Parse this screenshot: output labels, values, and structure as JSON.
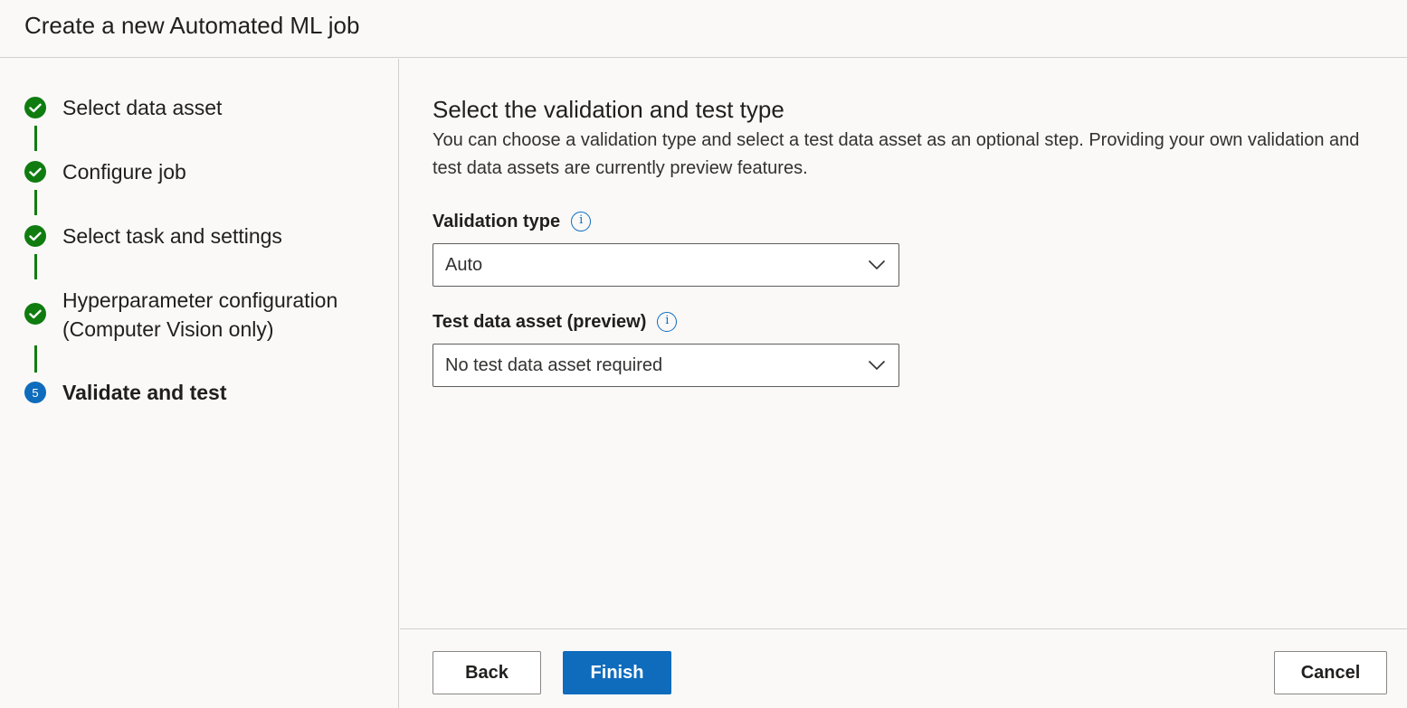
{
  "header": {
    "title": "Create a new Automated ML job"
  },
  "steps": [
    {
      "label": "Select data asset",
      "status": "completed",
      "icon": "checkmark-icon"
    },
    {
      "label": "Configure job",
      "status": "completed",
      "icon": "checkmark-icon"
    },
    {
      "label": "Select task and settings",
      "status": "completed",
      "icon": "checkmark-icon"
    },
    {
      "label_line1": "Hyperparameter configuration",
      "label_line2": "(Computer Vision only)",
      "status": "completed",
      "icon": "checkmark-icon"
    },
    {
      "label": "Validate and test",
      "status": "current",
      "number": "5"
    }
  ],
  "main": {
    "title": "Select the validation and test type",
    "description": "You can choose a validation type and select a test data asset as an optional step. Providing your own validation and test data assets are currently preview features.",
    "validation": {
      "label": "Validation type",
      "value": "Auto",
      "info_icon": "info-icon"
    },
    "test_data": {
      "label": "Test data asset (preview)",
      "value": "No test data asset required",
      "info_icon": "info-icon"
    }
  },
  "footer": {
    "back_label": "Back",
    "finish_label": "Finish",
    "cancel_label": "Cancel"
  },
  "colors": {
    "completed": "#107c10",
    "current": "#0f6cbd",
    "primary_button": "#0f6cbd",
    "background": "#faf9f8"
  }
}
